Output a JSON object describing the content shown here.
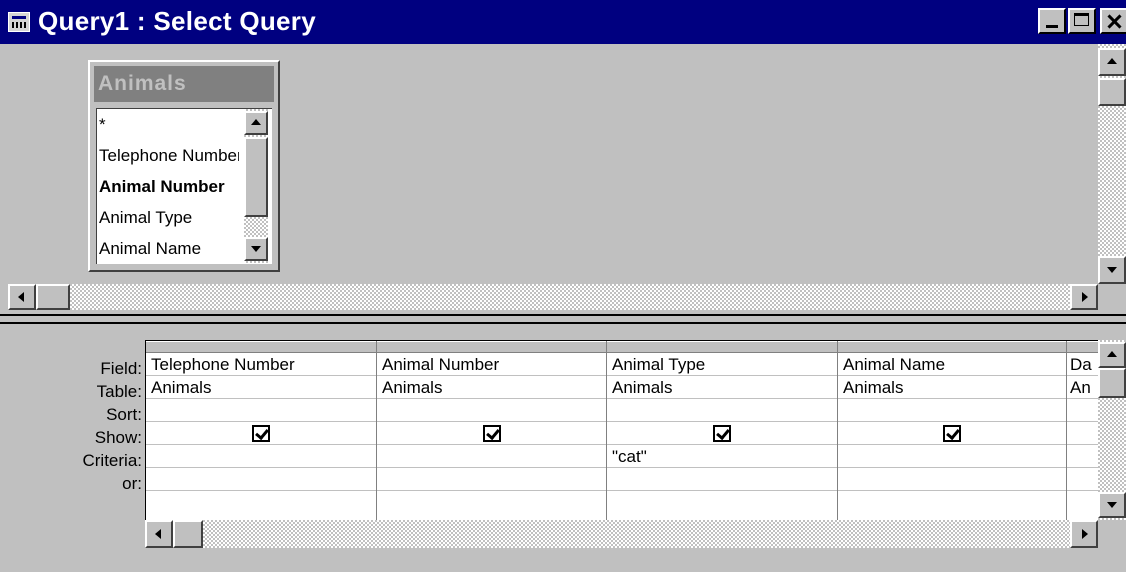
{
  "window": {
    "title": "Query1 : Select Query",
    "icon": "query-icon"
  },
  "field_list": {
    "title": "Animals",
    "items": [
      "*",
      "Telephone Number",
      "Animal Number",
      "Animal Type",
      "Animal Name"
    ],
    "bold_item": "Animal Number"
  },
  "grid": {
    "row_labels": [
      "Field:",
      "Table:",
      "Sort:",
      "Show:",
      "Criteria:",
      "or:"
    ],
    "columns": [
      {
        "field": "Telephone Number",
        "table": "Animals",
        "sort": "",
        "show": true,
        "criteria": "",
        "or": ""
      },
      {
        "field": "Animal Number",
        "table": "Animals",
        "sort": "",
        "show": true,
        "criteria": "",
        "or": ""
      },
      {
        "field": "Animal Type",
        "table": "Animals",
        "sort": "",
        "show": true,
        "criteria": "\"cat\"",
        "or": ""
      },
      {
        "field": "Animal Name",
        "table": "Animals",
        "sort": "",
        "show": true,
        "criteria": "",
        "or": ""
      },
      {
        "field": "Da",
        "table": "An",
        "sort": "",
        "show": false,
        "criteria": "",
        "or": ""
      }
    ]
  }
}
